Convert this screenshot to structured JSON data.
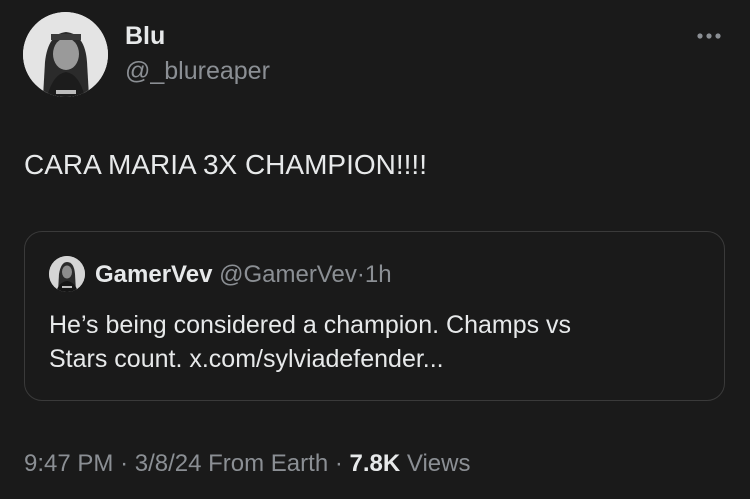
{
  "author": {
    "display_name": "Blu",
    "handle": "@_blureaper",
    "avatar_icon": "profile-avatar"
  },
  "more_icon": "more-dots-icon",
  "tweet": {
    "text": "CARA MARIA 3X CHAMPION!!!!"
  },
  "quote": {
    "display_name": "GamerVev",
    "handle": "@GamerVev",
    "separator": "·",
    "time": "1h",
    "body_line1": "He’s being considered a champion. Champs vs",
    "body_line2": "Stars count. x.com/sylviadefender..."
  },
  "meta": {
    "time": "9:47 PM",
    "sep1": "·",
    "date": "3/8/24",
    "location": "From Earth",
    "sep2": "·",
    "views_count": "7.8K",
    "views_label": "Views"
  },
  "colors": {
    "background": "#1a1a1a",
    "text_primary": "#e7e9ea",
    "text_secondary": "#8b8f94",
    "border": "#3a3a3a"
  }
}
